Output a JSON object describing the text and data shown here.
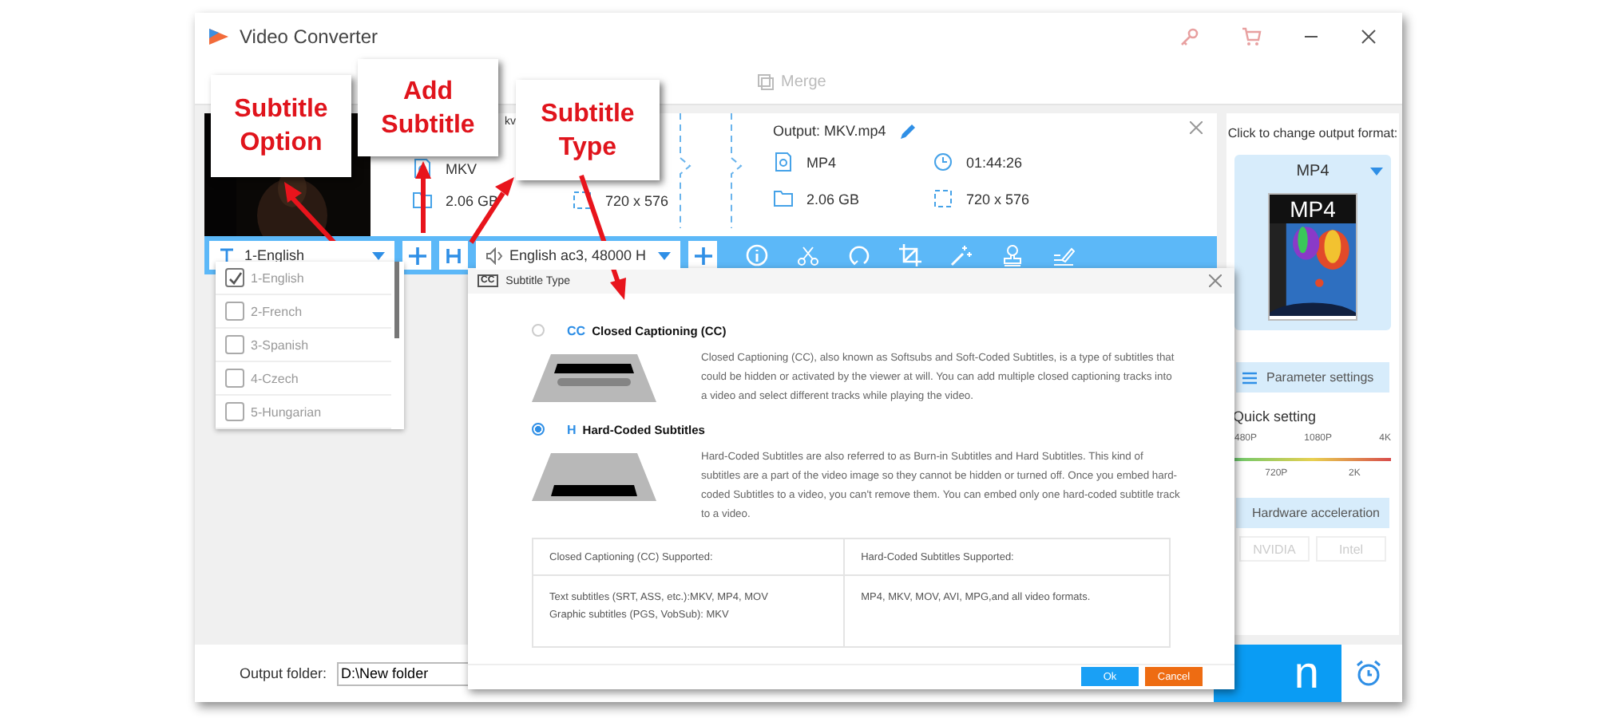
{
  "window": {
    "title": "Video Converter"
  },
  "toolbar_tabs": [
    {
      "label": "Merge",
      "disabled": true
    }
  ],
  "source": {
    "name_fragment": "kv",
    "format": "MKV",
    "size": "2.06 GB",
    "resolution": "720 x 576"
  },
  "output": {
    "title": "Output: MKV.mp4",
    "format": "MP4",
    "duration": "01:44:26",
    "size": "2.06 GB",
    "resolution": "720 x 576"
  },
  "subtitle_select": {
    "value": "1-English"
  },
  "subtitle_options": [
    {
      "label": "1-English",
      "checked": true
    },
    {
      "label": "2-French",
      "checked": false
    },
    {
      "label": "3-Spanish",
      "checked": false
    },
    {
      "label": "4-Czech",
      "checked": false
    },
    {
      "label": "5-Hungarian",
      "checked": false
    }
  ],
  "audio_select": {
    "value": "English ac3, 48000 H"
  },
  "callouts": [
    {
      "text": "Subtitle Option"
    },
    {
      "text": "Add Subtitle"
    },
    {
      "text": "Subtitle Type"
    }
  ],
  "right_panel": {
    "hint": "Click to change output format:",
    "format": "MP4",
    "format_badge": "MP4",
    "parameter_button": "Parameter settings",
    "quick_setting": "Quick setting",
    "scale_top": [
      "480P",
      "1080P",
      "4K"
    ],
    "scale_bottom": [
      "720P",
      "2K"
    ],
    "hw_button": "Hardware acceleration",
    "gpus": [
      {
        "label": "NVIDIA",
        "disabled": true
      },
      {
        "label": "Intel",
        "disabled": true
      }
    ]
  },
  "output_folder": {
    "label": "Output folder:",
    "value": "D:\\New folder"
  },
  "run_button": {
    "label": "n"
  },
  "dialog": {
    "icon_text": "CC",
    "title": "Subtitle Type",
    "options": [
      {
        "kind": "cc",
        "icon_text": "CC",
        "label": "Closed Captioning (CC)",
        "selected": false,
        "description": "Closed Captioning (CC), also known as Softsubs and Soft-Coded Subtitles, is a type of subtitles that could be hidden or activated by the viewer at will. You can add multiple closed captioning tracks into a video and select different tracks while playing the video."
      },
      {
        "kind": "hard",
        "icon_text": "H",
        "label": "Hard-Coded Subtitles",
        "selected": true,
        "description": "Hard-Coded Subtitles are also referred to as Burn-in Subtitles and Hard Subtitles. This kind of subtitles are a part of the video image so they cannot be hidden or turned off. Once you embed hard-coded Subtitles to a video, you can't remove them. You can embed only one hard-coded subtitle track to a video."
      }
    ],
    "table": {
      "columns": [
        "Closed Captioning (CC) Supported:",
        "Hard-Coded Subtitles Supported:"
      ],
      "rows": [
        [
          [
            "Text subtitles (SRT, ASS, etc.):MKV, MP4, MOV",
            "Graphic subtitles (PGS, VobSub): MKV"
          ],
          [
            "MP4, MKV, MOV, AVI, MPG,and all video formats."
          ]
        ]
      ]
    },
    "buttons": [
      {
        "label": "Ok",
        "kind": "primary"
      },
      {
        "label": "Cancel",
        "kind": "secondary"
      }
    ]
  }
}
